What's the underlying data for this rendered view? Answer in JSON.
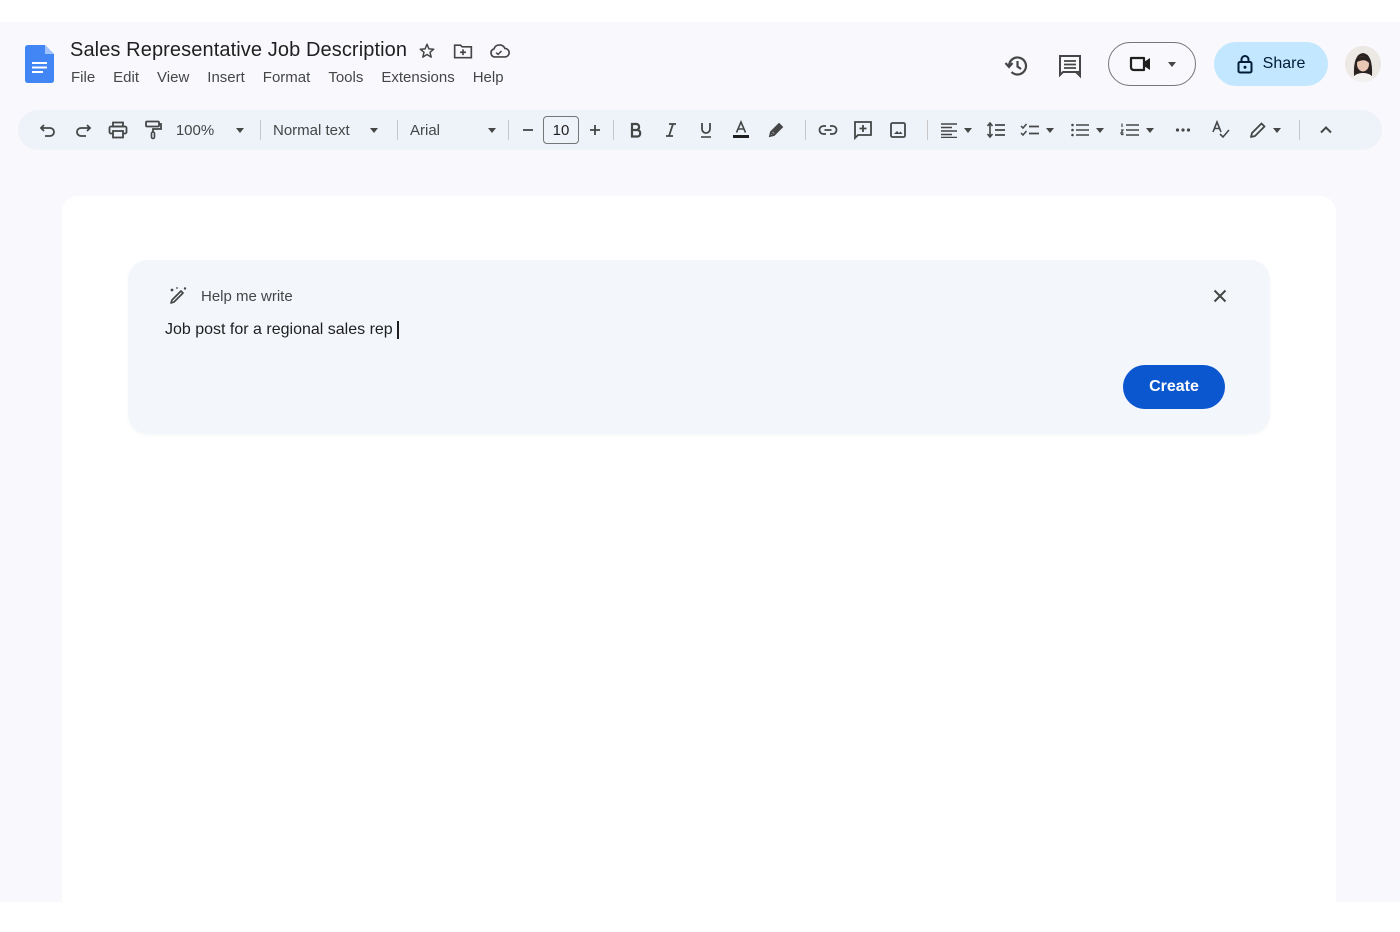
{
  "document": {
    "title": "Sales Representative Job Description"
  },
  "title_icons": [
    "star-icon",
    "move-to-folder-icon",
    "cloud-saved-icon"
  ],
  "menu": [
    {
      "label": "File"
    },
    {
      "label": "Edit"
    },
    {
      "label": "View"
    },
    {
      "label": "Insert"
    },
    {
      "label": "Format"
    },
    {
      "label": "Tools"
    },
    {
      "label": "Extensions"
    },
    {
      "label": "Help"
    }
  ],
  "header_actions": {
    "share_label": "Share",
    "share_color": "#c2e7ff"
  },
  "toolbar": {
    "zoom": "100%",
    "style": "Normal text",
    "font": "Arial",
    "font_size": "10"
  },
  "help_me_write": {
    "title": "Help me write",
    "prompt_value": "Job post for a regional sales rep",
    "create_label": "Create",
    "accent_color": "#0b57d0"
  }
}
